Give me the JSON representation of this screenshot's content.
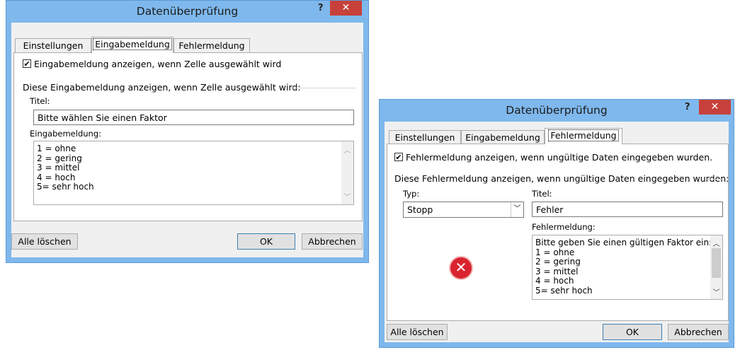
{
  "dialog_left": {
    "title": "Datenüberprüfung",
    "help": "?",
    "close": "✕",
    "tabs": [
      "Einstellungen",
      "Eingabemeldung",
      "Fehlermeldung"
    ],
    "checkbox_label": "Eingabemeldung anzeigen, wenn Zelle ausgewählt wird",
    "checked": true,
    "group_label": "Diese Eingabemeldung anzeigen, wenn Zelle ausgewählt wird:",
    "title_label": "Titel:",
    "title_value": "Bitte wählen Sie einen Faktor",
    "message_label": "Eingabemeldung:",
    "message_lines": [
      "1 = ohne",
      "2 = gering",
      "3 = mittel",
      "4 = hoch",
      "5= sehr hoch"
    ],
    "clear_button": "Alle löschen",
    "ok_button": "OK",
    "cancel_button": "Abbrechen"
  },
  "dialog_right": {
    "title": "Datenüberprüfung",
    "help": "?",
    "close": "✕",
    "tabs": [
      "Einstellungen",
      "Eingabemeldung",
      "Fehlermeldung"
    ],
    "checkbox_label": "Fehlermeldung anzeigen, wenn ungültige Daten eingegeben wurden.",
    "checked": true,
    "group_label": "Diese Fehlermeldung anzeigen, wenn ungültige Daten eingegeben wurden:",
    "type_label": "Typ:",
    "type_value": "Stopp",
    "title_label": "Titel:",
    "title_value": "Fehler",
    "message_label": "Fehlermeldung:",
    "message_lines": [
      "Bitte geben Sie einen gültigen Faktor ein:",
      "1 = ohne",
      "2 = gering",
      "3 = mittel",
      "4 = hoch",
      "5= sehr hoch"
    ],
    "icon": "error-stop-icon",
    "clear_button": "Alle löschen",
    "ok_button": "OK",
    "cancel_button": "Abbrechen"
  }
}
